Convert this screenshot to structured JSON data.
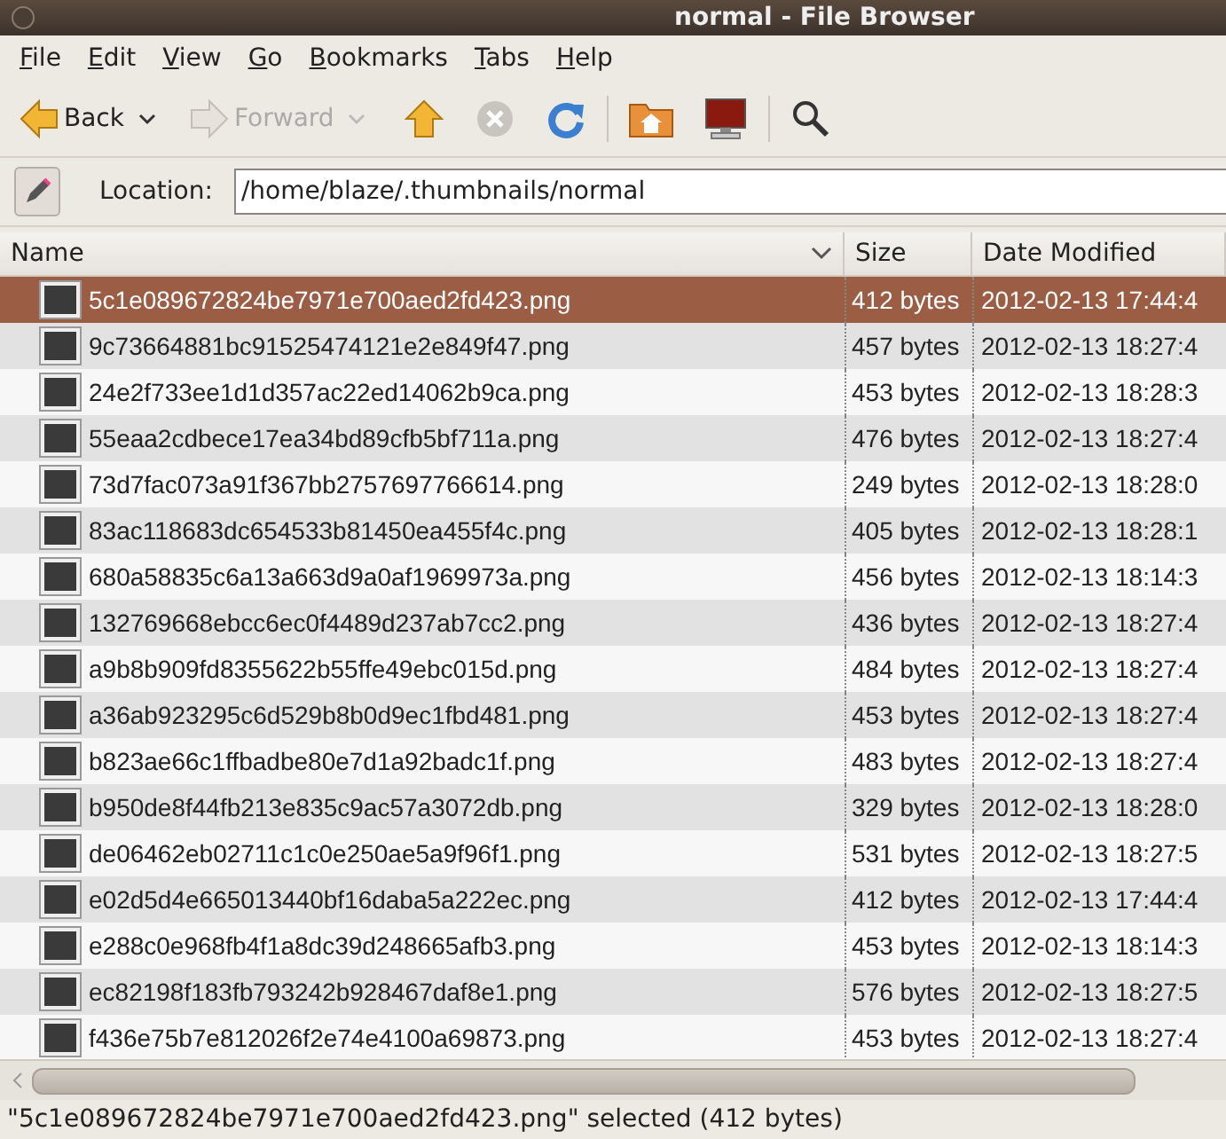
{
  "window": {
    "title": "normal - File Browser"
  },
  "menu": [
    "File",
    "Edit",
    "View",
    "Go",
    "Bookmarks",
    "Tabs",
    "Help"
  ],
  "toolbar": {
    "back": {
      "label": "Back",
      "disabled": false
    },
    "forward": {
      "label": "Forward",
      "disabled": true
    },
    "stop": {
      "disabled": true
    }
  },
  "location": {
    "label": "Location:",
    "value": "/home/blaze/.thumbnails/normal"
  },
  "table": {
    "columns": [
      "Name",
      "Size",
      "Date Modified"
    ],
    "rows": [
      {
        "name": "5c1e089672824be7971e700aed2fd423.png",
        "size": "412 bytes",
        "date": "2012-02-13 17:44:4",
        "selected": true
      },
      {
        "name": "9c73664881bc91525474121e2e849f47.png",
        "size": "457 bytes",
        "date": "2012-02-13 18:27:4",
        "selected": false
      },
      {
        "name": "24e2f733ee1d1d357ac22ed14062b9ca.png",
        "size": "453 bytes",
        "date": "2012-02-13 18:28:3",
        "selected": false
      },
      {
        "name": "55eaa2cdbece17ea34bd89cfb5bf711a.png",
        "size": "476 bytes",
        "date": "2012-02-13 18:27:4",
        "selected": false
      },
      {
        "name": "73d7fac073a91f367bb2757697766614.png",
        "size": "249 bytes",
        "date": "2012-02-13 18:28:0",
        "selected": false
      },
      {
        "name": "83ac118683dc654533b81450ea455f4c.png",
        "size": "405 bytes",
        "date": "2012-02-13 18:28:1",
        "selected": false
      },
      {
        "name": "680a58835c6a13a663d9a0af1969973a.png",
        "size": "456 bytes",
        "date": "2012-02-13 18:14:3",
        "selected": false
      },
      {
        "name": "132769668ebcc6ec0f4489d237ab7cc2.png",
        "size": "436 bytes",
        "date": "2012-02-13 18:27:4",
        "selected": false
      },
      {
        "name": "a9b8b909fd8355622b55ffe49ebc015d.png",
        "size": "484 bytes",
        "date": "2012-02-13 18:27:4",
        "selected": false
      },
      {
        "name": "a36ab923295c6d529b8b0d9ec1fbd481.png",
        "size": "453 bytes",
        "date": "2012-02-13 18:27:4",
        "selected": false
      },
      {
        "name": "b823ae66c1ffbadbe80e7d1a92badc1f.png",
        "size": "483 bytes",
        "date": "2012-02-13 18:27:4",
        "selected": false
      },
      {
        "name": "b950de8f44fb213e835c9ac57a3072db.png",
        "size": "329 bytes",
        "date": "2012-02-13 18:28:0",
        "selected": false
      },
      {
        "name": "de06462eb02711c1c0e250ae5a9f96f1.png",
        "size": "531 bytes",
        "date": "2012-02-13 18:27:5",
        "selected": false
      },
      {
        "name": "e02d5d4e665013440bf16daba5a222ec.png",
        "size": "412 bytes",
        "date": "2012-02-13 17:44:4",
        "selected": false
      },
      {
        "name": "e288c0e968fb4f1a8dc39d248665afb3.png",
        "size": "453 bytes",
        "date": "2012-02-13 18:14:3",
        "selected": false
      },
      {
        "name": "ec82198f183fb793242b928467daf8e1.png",
        "size": "576 bytes",
        "date": "2012-02-13 18:27:5",
        "selected": false
      },
      {
        "name": "f436e75b7e812026f2e74e4100a69873.png",
        "size": "453 bytes",
        "date": "2012-02-13 18:27:4",
        "selected": false
      }
    ]
  },
  "status_bar": "\"5c1e089672824be7971e700aed2fd423.png\" selected (412 bytes)"
}
